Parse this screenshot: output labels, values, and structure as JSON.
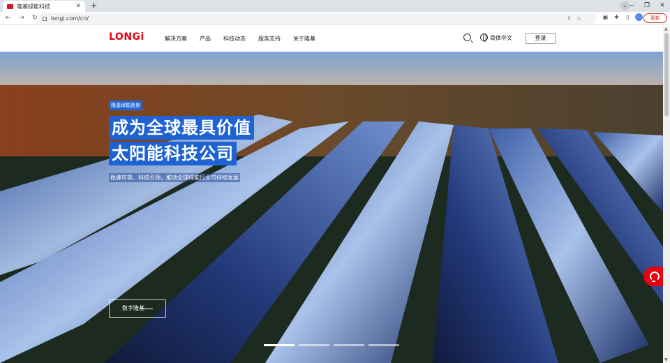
{
  "browser": {
    "tab_title": "隆基绿能科技",
    "url": "longi.com/cn/",
    "update_label": "更新"
  },
  "site": {
    "logo": "LONGi",
    "nav": [
      "解决方案",
      "产品",
      "科技动态",
      "服务支持",
      "关于隆基"
    ],
    "lang": "简体中文",
    "login": "登录"
  },
  "hero": {
    "eyebrow": "隆基绿能愿景",
    "headline_1": "成为全球最具价值",
    "headline_2": "太阳能科技公司",
    "subline": "稳健可靠、科技引领，推动全球绿能行业可持续发展",
    "cta": "数字隆基",
    "slides_total": 4,
    "slide_active": 1
  },
  "colors": {
    "brand_red": "#e60012",
    "highlight_blue": "#1e63d1"
  }
}
